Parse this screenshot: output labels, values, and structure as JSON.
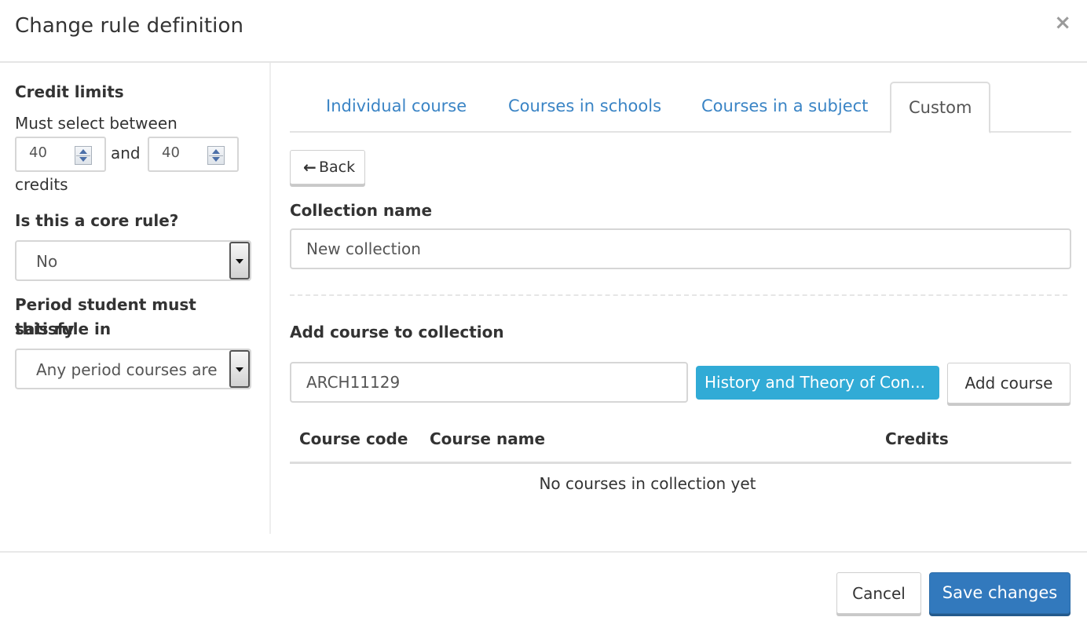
{
  "modal": {
    "title": "Change rule definition",
    "close_label": "×"
  },
  "left": {
    "credit_limits": {
      "label": "Credit limits",
      "prefix": "Must select between",
      "min_value": "40",
      "connector": "and",
      "max_value": "40",
      "suffix": "credits"
    },
    "core_rule": {
      "label": "Is this a core rule?",
      "selected": "No"
    },
    "period": {
      "label_line1": "Period student must satisfy",
      "label_line2": "this rule in",
      "selected": "Any period courses are"
    }
  },
  "tabs": [
    {
      "label": "Individual course",
      "active": false
    },
    {
      "label": "Courses in schools",
      "active": false
    },
    {
      "label": "Courses in a subject",
      "active": false
    },
    {
      "label": "Custom",
      "active": true
    }
  ],
  "custom": {
    "back_label": "Back",
    "collection_name_label": "Collection name",
    "collection_name_value": "New collection",
    "add_course_label": "Add course to collection",
    "course_code_value": "ARCH11129",
    "course_suggestion": "History and Theory of Con...",
    "add_course_button": "Add course",
    "table": {
      "columns": [
        "Course code",
        "Course name",
        "Credits"
      ],
      "rows": [],
      "empty_message": "No courses in collection yet"
    }
  },
  "footer": {
    "cancel_label": "Cancel",
    "save_label": "Save changes"
  },
  "colors": {
    "link": "#3a84c5",
    "primary": "#3279bd",
    "info": "#31abd6"
  }
}
